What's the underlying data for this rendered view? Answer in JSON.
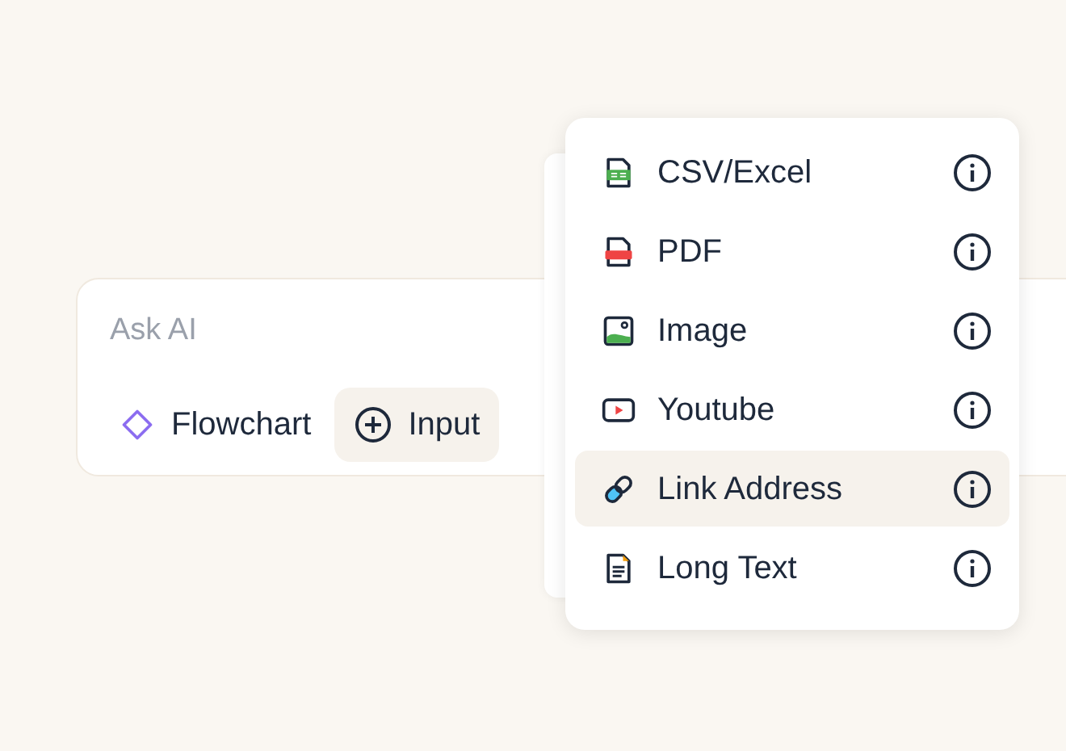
{
  "prompt": {
    "placeholder": "Ask AI"
  },
  "chips": [
    {
      "kind": "flowchart",
      "label": "Flowchart",
      "selected": false
    },
    {
      "kind": "input",
      "label": "Input",
      "selected": true
    }
  ],
  "menu": {
    "items": [
      {
        "kind": "csv",
        "label": "CSV/Excel",
        "selected": false
      },
      {
        "kind": "pdf",
        "label": "PDF",
        "selected": false
      },
      {
        "kind": "image",
        "label": "Image",
        "selected": false
      },
      {
        "kind": "youtube",
        "label": "Youtube",
        "selected": false
      },
      {
        "kind": "link",
        "label": "Link Address",
        "selected": true
      },
      {
        "kind": "text",
        "label": "Long Text",
        "selected": false
      }
    ]
  }
}
